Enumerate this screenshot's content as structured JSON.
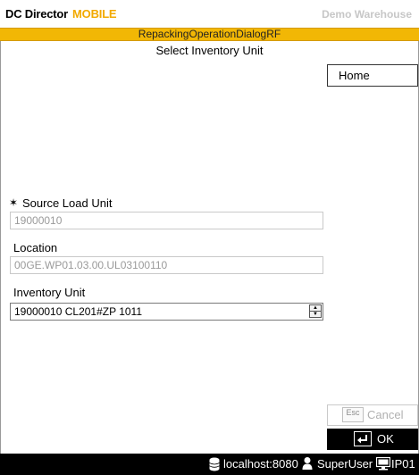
{
  "header": {
    "app_name": "DC Director",
    "app_edition": "MOBILE",
    "warehouse": "Demo Warehouse"
  },
  "dialog": {
    "title": "RepackingOperationDialogRF",
    "subtitle": "Select Inventory Unit"
  },
  "nav": {
    "home_label": "Home"
  },
  "form": {
    "required_marker": "✶",
    "source_load_unit": {
      "label": "Source Load Unit",
      "value": "19000010"
    },
    "location": {
      "label": "Location",
      "value": "00GE.WP01.03.00.UL03100110"
    },
    "inventory_unit": {
      "label": "Inventory Unit",
      "value": "19000010 CL201#ZP 1011"
    }
  },
  "actions": {
    "cancel_key": "Esc",
    "cancel_label": "Cancel",
    "ok_label": "OK"
  },
  "status": {
    "server": "localhost:8080",
    "user": "SuperUser",
    "terminal": "IP01"
  },
  "colors": {
    "accent": "#f2b705",
    "mobile_text": "#f2a900",
    "footer_bg": "#000000"
  },
  "icons": [
    "database-icon",
    "user-icon",
    "monitor-icon",
    "enter-key-icon",
    "arrow-up-icon",
    "arrow-down-icon"
  ]
}
